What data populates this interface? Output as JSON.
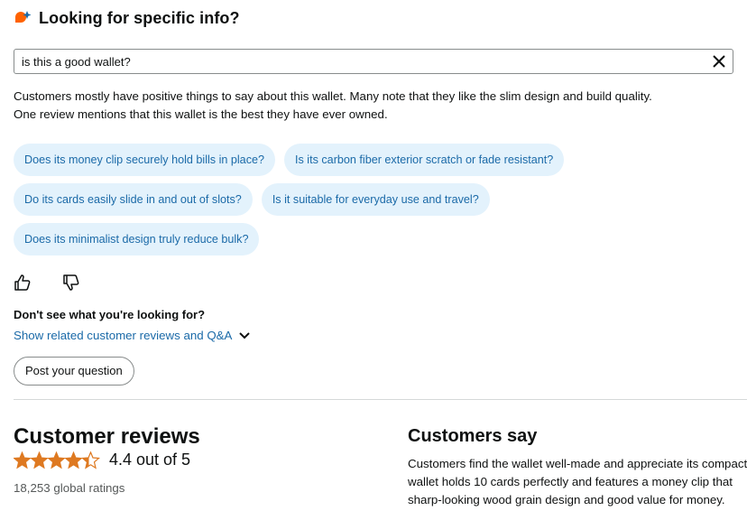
{
  "header": {
    "title": "Looking for specific info?",
    "icon": "ai-sparkle-chat-icon"
  },
  "search": {
    "value": "is this a good wallet?"
  },
  "answer": {
    "line1": "Customers mostly have positive things to say about this wallet. Many note that they like the slim design and build quality.",
    "line2": "One review mentions that this wallet is the best they have ever owned."
  },
  "suggestions": [
    "Does its money clip securely hold bills in place?",
    "Is its carbon fiber exterior scratch or fade resistant?",
    "Do its cards easily slide in and out of slots?",
    "Is it suitable for everyday use and travel?",
    "Does its minimalist design truly reduce bulk?"
  ],
  "feedback": {
    "up_icon": "thumbs-up-icon",
    "down_icon": "thumbs-down-icon"
  },
  "more": {
    "heading": "Don't see what you're looking for?",
    "link": "Show related customer reviews and Q&A",
    "post_button": "Post your question"
  },
  "reviews": {
    "title": "Customer reviews",
    "rating": 4.4,
    "rating_text": "4.4 out of 5",
    "global_ratings": "18,253 global ratings"
  },
  "customers_say": {
    "title": "Customers say",
    "lines": [
      "Customers find the wallet well-made and appreciate its compact size.",
      "wallet holds 10 cards perfectly and features a money clip that",
      "sharp-looking wood grain design and good value for money."
    ]
  },
  "colors": {
    "accent": "#ff6200",
    "link": "#1b6aa8",
    "chip_bg": "#e3f2fc",
    "star": "#de7921"
  }
}
